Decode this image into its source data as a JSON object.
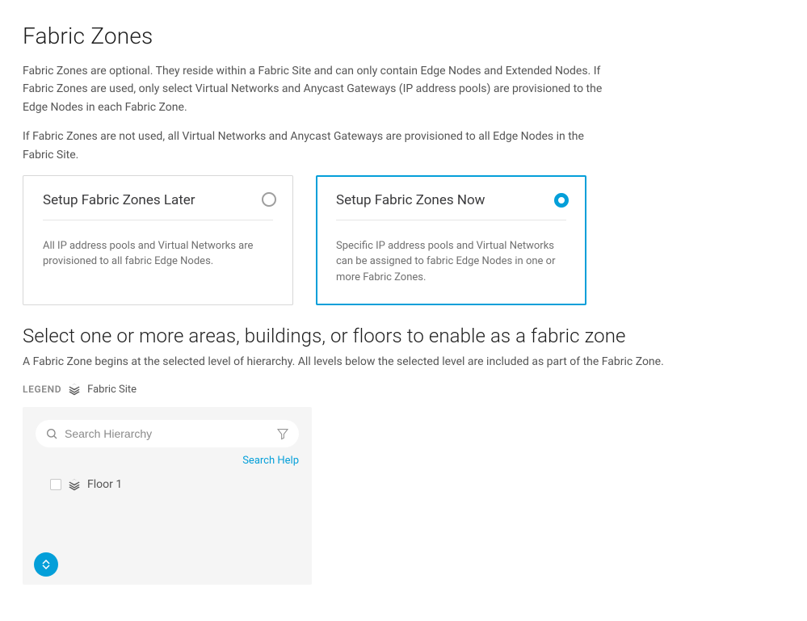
{
  "page": {
    "title": "Fabric Zones",
    "intro1": "Fabric Zones are optional. They reside within a Fabric Site and can only contain Edge Nodes and Extended Nodes. If Fabric Zones are used, only select Virtual Networks and Anycast Gateways (IP address pools) are provisioned to the Edge Nodes in each Fabric Zone.",
    "intro2": "If Fabric Zones are not used, all Virtual Networks and Anycast Gateways are provisioned to all Edge Nodes in the Fabric Site."
  },
  "options": {
    "later": {
      "title": "Setup Fabric Zones Later",
      "desc": "All IP address pools and Virtual Networks are provisioned to all fabric Edge Nodes."
    },
    "now": {
      "title": "Setup Fabric Zones Now",
      "desc": "Specific IP address pools and Virtual Networks can be assigned to fabric Edge Nodes in one or more Fabric Zones."
    }
  },
  "selection": {
    "heading": "Select one or more areas, buildings, or floors to enable as a fabric zone",
    "subtext": "A Fabric Zone begins at the selected level of hierarchy. All levels below the selected level are included as part of the Fabric Zone."
  },
  "legend": {
    "label": "LEGEND",
    "site": "Fabric Site"
  },
  "hierarchy": {
    "search_placeholder": "Search Hierarchy",
    "search_help": "Search Help",
    "items": [
      {
        "label": "Floor 1"
      }
    ]
  }
}
